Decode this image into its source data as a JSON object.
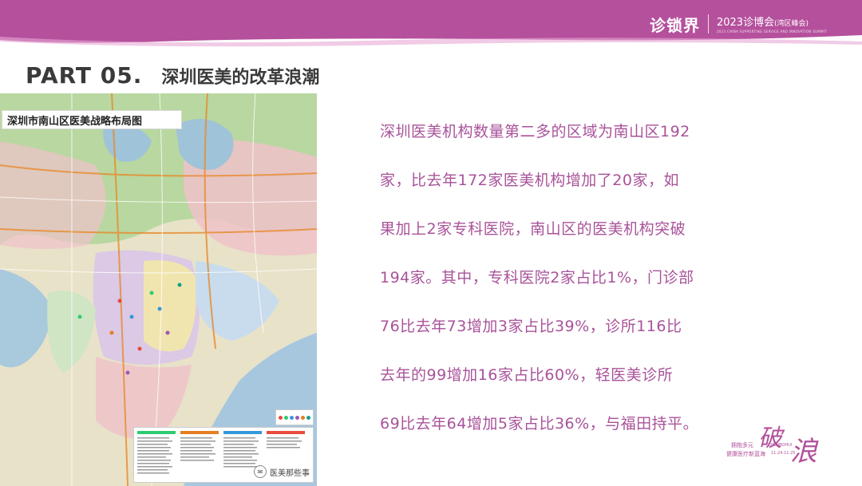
{
  "header": {
    "brand_logo": "诊锁界",
    "event_title": "2023诊博会",
    "event_sub": "(湾区峰会)",
    "event_en": "2023 CHINA SUPPORTING SERVICE AND INNOVATION SUMMIT",
    "band_color": "#b5509d"
  },
  "slide": {
    "part": "PART 05.",
    "heading": "深圳医美的改革浪潮"
  },
  "map": {
    "title": "深圳市南山区医美战略布局图",
    "legend_colors": [
      "#e74c3c",
      "#2ecc71",
      "#3498db",
      "#9b59b6",
      "#e67e22",
      "#16a085"
    ],
    "watermark": "医美那些事"
  },
  "body": {
    "lines": [
      "深圳医美机构数量第二多的区域为南山区192",
      "家，比去年172家医美机构增加了20家，如",
      "果加上2家专科医院，南山区的医美机构突破",
      "194家。其中，专科医院2家占比1%，门诊部",
      "76比去年73增加3家占比39%，诊所116比",
      "去年的99增加16家占比60%，轻医美诊所",
      "69比去年64增加5家占比36%，与福田持平。"
    ],
    "text_color": "#a8539a"
  },
  "stamp": {
    "char1": "破",
    "char2": "浪",
    "line1": "拥抱多元",
    "line2": "健康医疗新蓝海",
    "en": "ZHENBOHUI",
    "date": "11.24-11.25"
  }
}
